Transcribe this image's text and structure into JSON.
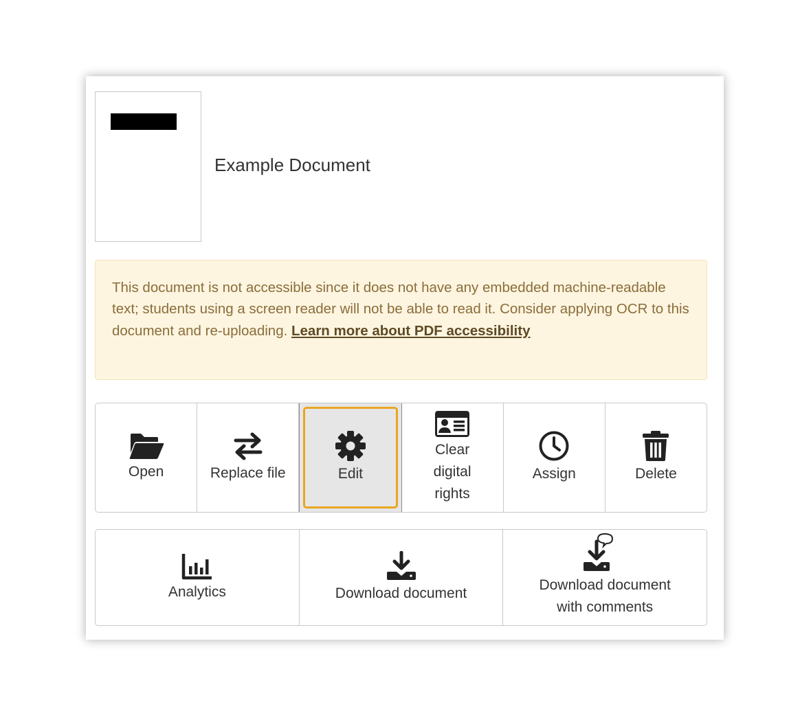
{
  "document": {
    "title": "Example Document"
  },
  "notice": {
    "text": "This document is not accessible since it does not have any embedded machine-readable text; students using a screen reader will not be able to read it. Consider applying OCR to this document and re-uploading. ",
    "link_label": "Learn more about PDF accessibility"
  },
  "actions_row1": [
    {
      "label": "Open",
      "icon": "folder-open-icon"
    },
    {
      "label": "Replace file",
      "icon": "arrows-exchange-icon"
    },
    {
      "label": "Edit",
      "icon": "gear-icon"
    },
    {
      "label": "Clear digital rights",
      "icon": "id-card-icon"
    },
    {
      "label": "Assign",
      "icon": "clock-icon"
    },
    {
      "label": "Delete",
      "icon": "trash-icon"
    }
  ],
  "actions_row2": [
    {
      "label": "Analytics",
      "icon": "bar-chart-icon"
    },
    {
      "label": "Download document",
      "icon": "download-icon"
    },
    {
      "label": "Download document with comments",
      "icon": "download-comment-icon"
    }
  ],
  "colors": {
    "notice_bg": "#fdf5e0",
    "notice_text": "#8a6d3b",
    "focus_ring": "#e9a623",
    "active_bg": "#e6e6e6"
  }
}
